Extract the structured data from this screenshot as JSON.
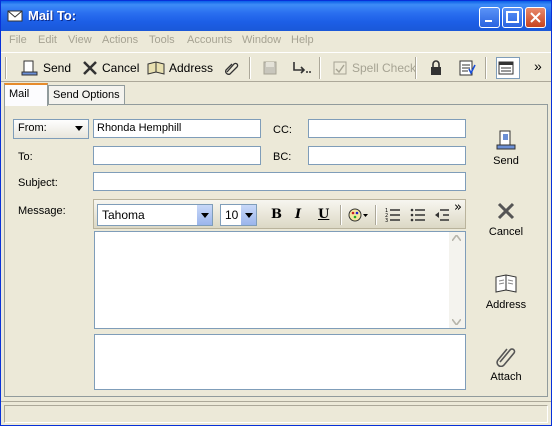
{
  "window": {
    "title": "Mail To:"
  },
  "menubar": {
    "items": [
      "File",
      "Edit",
      "View",
      "Actions",
      "Tools",
      "Accounts",
      "Window",
      "Help"
    ]
  },
  "toolbar": {
    "send_label": "Send",
    "cancel_label": "Cancel",
    "address_label": "Address",
    "spell_check_label": "Spell Check",
    "overflow_label": "»"
  },
  "tabs": [
    {
      "label": "Mail"
    },
    {
      "label": "Send Options"
    }
  ],
  "form": {
    "from_label": "From:",
    "from_value": "Rhonda Hemphill",
    "cc_label": "CC:",
    "to_label": "To:",
    "bc_label": "BC:",
    "subject_label": "Subject:",
    "message_label": "Message:"
  },
  "format": {
    "font_name": "Tahoma",
    "font_size": "10",
    "bold": "B",
    "italic": "I",
    "underline": "U",
    "overflow": "»"
  },
  "side_actions": {
    "send": "Send",
    "cancel": "Cancel",
    "address": "Address",
    "attach": "Attach"
  }
}
